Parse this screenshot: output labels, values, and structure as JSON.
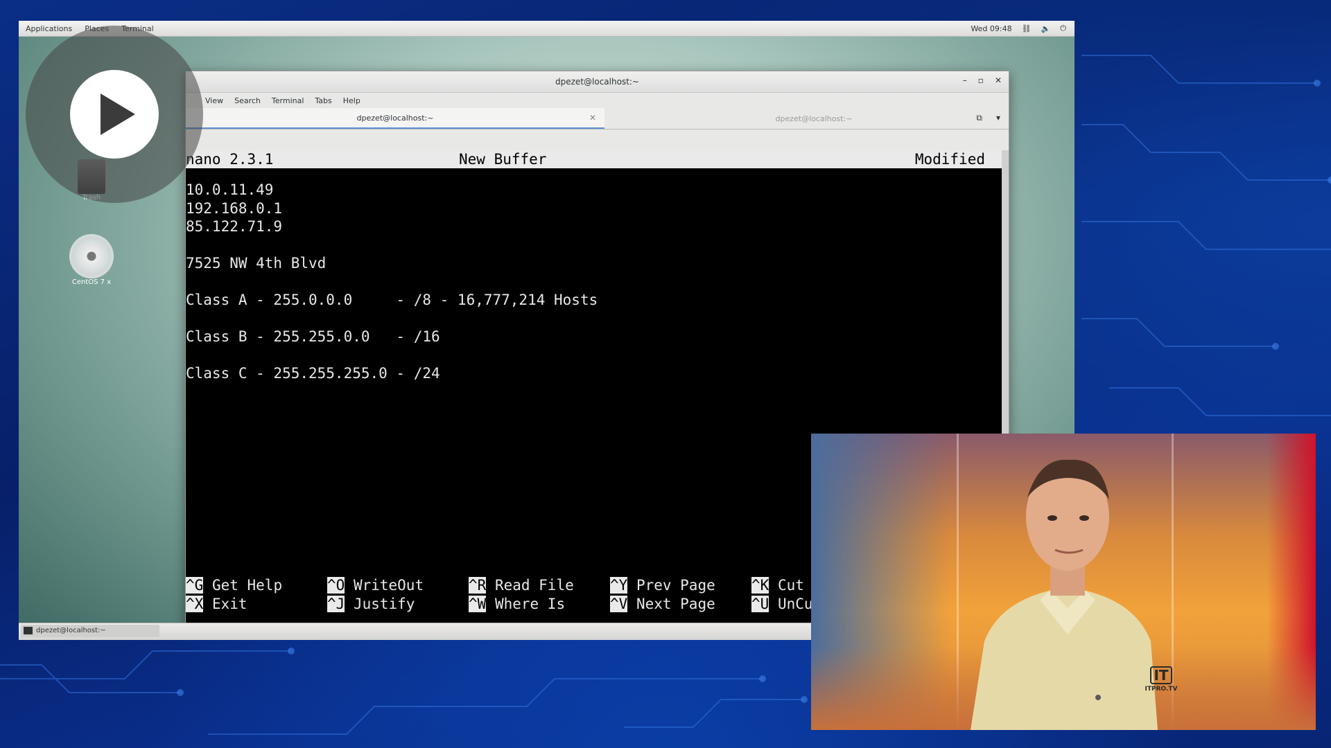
{
  "top_bar": {
    "menu": [
      "Applications",
      "Places",
      "Terminal"
    ],
    "clock": "Wed 09:48"
  },
  "desktop": {
    "icons": [
      {
        "label": "Trash"
      },
      {
        "label": "CentOS 7 x"
      }
    ]
  },
  "window": {
    "title": "dpezet@localhost:~",
    "menu": [
      "View",
      "Search",
      "Terminal",
      "Tabs",
      "Help"
    ],
    "tabs": [
      {
        "label": "dpezet@localhost:~",
        "active": true
      },
      {
        "label": "dpezet@localhost:~",
        "active": false
      }
    ]
  },
  "nano": {
    "version": "nano 2.3.1",
    "buffer": "New Buffer",
    "status": "Modified",
    "lines": [
      "10.0.11.49",
      "192.168.0.1",
      "85.122.71.9",
      "",
      "7525 NW 4th Blvd",
      "",
      "Class A - 255.0.0.0     - /8 - 16,777,214 Hosts",
      "",
      "Class B - 255.255.0.0   - /16",
      "",
      "Class C - 255.255.255.0 - /24"
    ],
    "shortcuts": [
      [
        {
          "key": "^G",
          "label": "Get Help"
        },
        {
          "key": "^O",
          "label": "WriteOut"
        },
        {
          "key": "^R",
          "label": "Read File"
        },
        {
          "key": "^Y",
          "label": "Prev Page"
        },
        {
          "key": "^K",
          "label": "Cut Text"
        }
      ],
      [
        {
          "key": "^X",
          "label": "Exit"
        },
        {
          "key": "^J",
          "label": "Justify"
        },
        {
          "key": "^W",
          "label": "Where Is"
        },
        {
          "key": "^V",
          "label": "Next Page"
        },
        {
          "key": "^U",
          "label": "UnCut Text"
        }
      ]
    ]
  },
  "taskbar": {
    "item": "dpezet@localhost:~"
  },
  "presenter": {
    "logo_mark": "IT",
    "logo_text": "ITPRO.TV"
  },
  "colors": {
    "background": "#0a2e86",
    "terminal_bg": "#000000",
    "nano_bar": "#eaeaea"
  }
}
